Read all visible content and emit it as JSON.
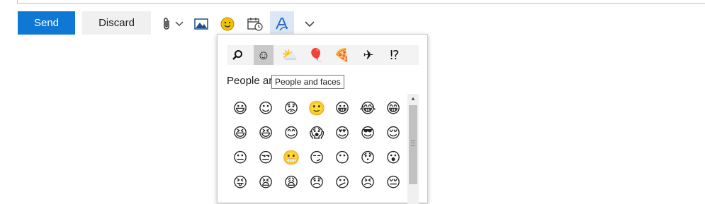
{
  "toolbar": {
    "send_label": "Send",
    "discard_label": "Discard",
    "attach_icon": "paperclip-icon",
    "attach_dropdown_icon": "chevron-down-icon",
    "picture_icon": "image-icon",
    "emoji_icon": "smiley-icon",
    "calendar_icon": "calendar-clock-icon",
    "format_icon": "text-format-icon",
    "more_icon": "chevron-down-icon"
  },
  "colors": {
    "send_bg": "#0f78d4",
    "discard_bg": "#f0f0f0",
    "emoji_icon_color": "#f2c200",
    "active_category_bg": "#c9c9c9",
    "format_active_bg": "#dbe7f5"
  },
  "picker": {
    "categories": [
      {
        "name": "search",
        "glyph": "⚲"
      },
      {
        "name": "people-and-faces",
        "glyph": "☺"
      },
      {
        "name": "weather",
        "glyph": "⛅"
      },
      {
        "name": "celebration",
        "glyph": "🎈"
      },
      {
        "name": "food",
        "glyph": "🍕"
      },
      {
        "name": "travel",
        "glyph": "✈"
      },
      {
        "name": "symbols",
        "glyph": "⁉"
      }
    ],
    "section_title": "People ar",
    "tooltip": "People and faces",
    "emoji_rows": [
      [
        "😃",
        "☺",
        "😟",
        "🙂",
        "😀",
        "😂",
        "😁"
      ],
      [
        "😆",
        "😆",
        "😊",
        "😱",
        "😍",
        "😎",
        "😌"
      ],
      [
        "😐",
        "😒",
        "😬",
        "😏",
        "😶",
        "😯",
        "😮"
      ],
      [
        "😝",
        "😫",
        "😩",
        "😞",
        "😕",
        "😣",
        "😔"
      ]
    ]
  }
}
